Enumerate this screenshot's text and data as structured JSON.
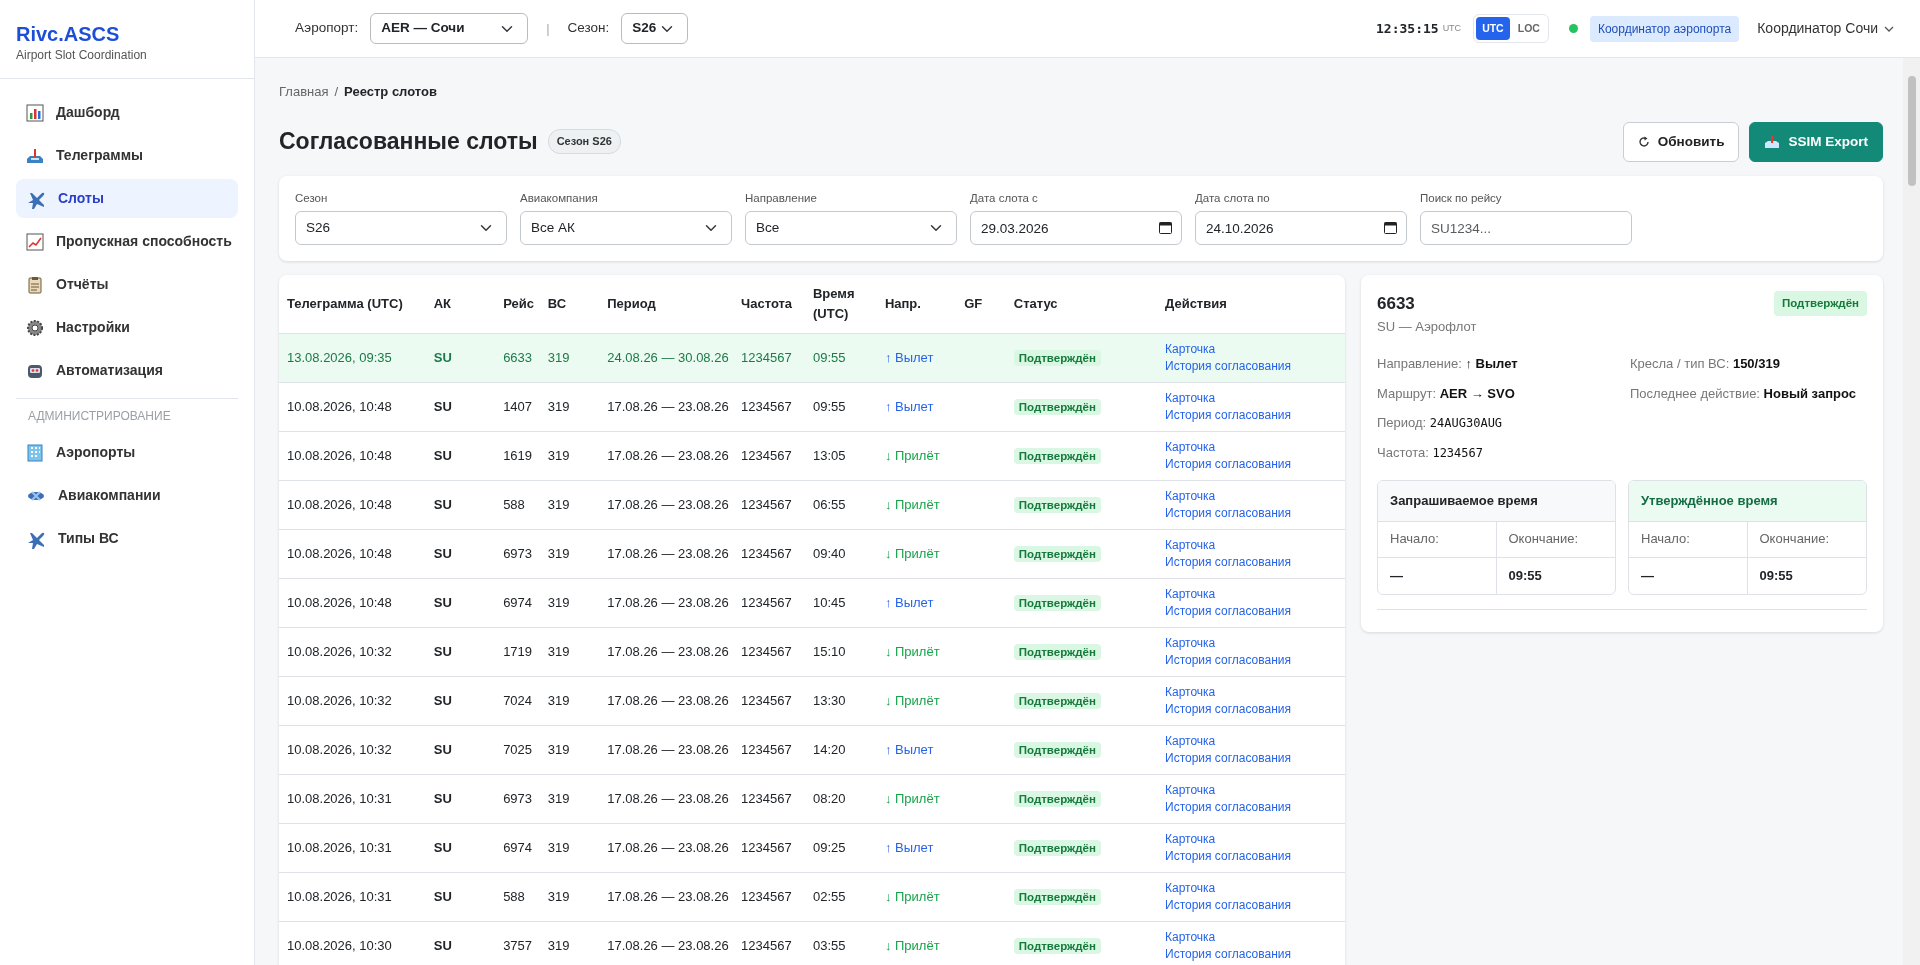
{
  "brand": {
    "title": "Rivc.ASCS",
    "subtitle": "Airport Slot Coordination"
  },
  "sidebar": {
    "items": [
      {
        "label": "Дашборд",
        "selected": false
      },
      {
        "label": "Телеграммы",
        "selected": false
      },
      {
        "label": "Слоты",
        "selected": true
      },
      {
        "label": "Пропускная способность",
        "selected": false
      },
      {
        "label": "Отчёты",
        "selected": false
      },
      {
        "label": "Настройки",
        "selected": false
      },
      {
        "label": "Автоматизация",
        "selected": false
      }
    ],
    "section_title": "АДМИНИСТРИРОВАНИЕ",
    "admin_items": [
      {
        "label": "Аэропорты",
        "selected": false
      },
      {
        "label": "Авиакомпании",
        "selected": false
      },
      {
        "label": "Типы ВС",
        "selected": false
      }
    ]
  },
  "topbar": {
    "airport_label": "Аэропорт:",
    "airport_value": "AER — Сочи",
    "separator": "|",
    "season_label": "Сезон:",
    "season_value": "S26",
    "clock": "12:35:15",
    "clock_zone": "UTC",
    "time_modes": [
      {
        "label": "UTC",
        "selected": true
      },
      {
        "label": "LOC",
        "selected": false
      }
    ],
    "online": true,
    "role_badge": "Координатор аэропорта",
    "user": "Координатор Сочи"
  },
  "breadcrumb": {
    "separator": "/",
    "items": [
      {
        "label": "Главная",
        "selected": false
      },
      {
        "label": "Реестр слотов",
        "selected": true
      }
    ]
  },
  "page": {
    "title": "Согласованные слоты",
    "season_badge": "Сезон S26",
    "buttons": [
      {
        "label": "Обновить",
        "kind": "refresh"
      },
      {
        "label": "SSIM Export",
        "kind": "export"
      }
    ]
  },
  "filters": [
    {
      "label": "Сезон",
      "kind": "select",
      "value": "S26"
    },
    {
      "label": "Авиакомпания",
      "kind": "select",
      "value": "Все АК"
    },
    {
      "label": "Направление",
      "kind": "select",
      "value": "Все"
    },
    {
      "label": "Дата слота с",
      "kind": "date",
      "value": "29.03.2026"
    },
    {
      "label": "Дата слота по",
      "kind": "date",
      "value": "24.10.2026"
    },
    {
      "label": "Поиск по рейсу",
      "kind": "text",
      "placeholder": "SU1234..."
    }
  ],
  "table": {
    "columns": [
      "Телеграмма (UTC)",
      "АК",
      "Рейс",
      "ВС",
      "Период",
      "Частота",
      "Время (UTC)",
      "Напр.",
      "GF",
      "Статус",
      "Действия"
    ],
    "rows": [
      {
        "telegram": "13.08.2026, 09:35",
        "airline": "SU",
        "flight": "6633",
        "aircraft": "319",
        "period": "24.08.26 — 30.08.26",
        "frequency": "1234567",
        "time": "09:55",
        "direction": "↑ Вылет",
        "kind": "dep",
        "status": "Подтверждён",
        "actions": [
          "Карточка",
          "История согласования"
        ],
        "selected": true
      },
      {
        "telegram": "10.08.2026, 10:48",
        "airline": "SU",
        "flight": "1407",
        "aircraft": "319",
        "period": "17.08.26 — 23.08.26",
        "frequency": "1234567",
        "time": "09:55",
        "direction": "↑ Вылет",
        "kind": "dep",
        "status": "Подтверждён",
        "actions": [
          "Карточка",
          "История согласования"
        ],
        "selected": false
      },
      {
        "telegram": "10.08.2026, 10:48",
        "airline": "SU",
        "flight": "1619",
        "aircraft": "319",
        "period": "17.08.26 — 23.08.26",
        "frequency": "1234567",
        "time": "13:05",
        "direction": "↓ Прилёт",
        "kind": "arr",
        "status": "Подтверждён",
        "actions": [
          "Карточка",
          "История согласования"
        ],
        "selected": false
      },
      {
        "telegram": "10.08.2026, 10:48",
        "airline": "SU",
        "flight": "588",
        "aircraft": "319",
        "period": "17.08.26 — 23.08.26",
        "frequency": "1234567",
        "time": "06:55",
        "direction": "↓ Прилёт",
        "kind": "arr",
        "status": "Подтверждён",
        "actions": [
          "Карточка",
          "История согласования"
        ],
        "selected": false
      },
      {
        "telegram": "10.08.2026, 10:48",
        "airline": "SU",
        "flight": "6973",
        "aircraft": "319",
        "period": "17.08.26 — 23.08.26",
        "frequency": "1234567",
        "time": "09:40",
        "direction": "↓ Прилёт",
        "kind": "arr",
        "status": "Подтверждён",
        "actions": [
          "Карточка",
          "История согласования"
        ],
        "selected": false
      },
      {
        "telegram": "10.08.2026, 10:48",
        "airline": "SU",
        "flight": "6974",
        "aircraft": "319",
        "period": "17.08.26 — 23.08.26",
        "frequency": "1234567",
        "time": "10:45",
        "direction": "↑ Вылет",
        "kind": "dep",
        "status": "Подтверждён",
        "actions": [
          "Карточка",
          "История согласования"
        ],
        "selected": false
      },
      {
        "telegram": "10.08.2026, 10:32",
        "airline": "SU",
        "flight": "1719",
        "aircraft": "319",
        "period": "17.08.26 — 23.08.26",
        "frequency": "1234567",
        "time": "15:10",
        "direction": "↓ Прилёт",
        "kind": "arr",
        "status": "Подтверждён",
        "actions": [
          "Карточка",
          "История согласования"
        ],
        "selected": false
      },
      {
        "telegram": "10.08.2026, 10:32",
        "airline": "SU",
        "flight": "7024",
        "aircraft": "319",
        "period": "17.08.26 — 23.08.26",
        "frequency": "1234567",
        "time": "13:30",
        "direction": "↓ Прилёт",
        "kind": "arr",
        "status": "Подтверждён",
        "actions": [
          "Карточка",
          "История согласования"
        ],
        "selected": false
      },
      {
        "telegram": "10.08.2026, 10:32",
        "airline": "SU",
        "flight": "7025",
        "aircraft": "319",
        "period": "17.08.26 — 23.08.26",
        "frequency": "1234567",
        "time": "14:20",
        "direction": "↑ Вылет",
        "kind": "dep",
        "status": "Подтверждён",
        "actions": [
          "Карточка",
          "История согласования"
        ],
        "selected": false
      },
      {
        "telegram": "10.08.2026, 10:31",
        "airline": "SU",
        "flight": "6973",
        "aircraft": "319",
        "period": "17.08.26 — 23.08.26",
        "frequency": "1234567",
        "time": "08:20",
        "direction": "↓ Прилёт",
        "kind": "arr",
        "status": "Подтверждён",
        "actions": [
          "Карточка",
          "История согласования"
        ],
        "selected": false
      },
      {
        "telegram": "10.08.2026, 10:31",
        "airline": "SU",
        "flight": "6974",
        "aircraft": "319",
        "period": "17.08.26 — 23.08.26",
        "frequency": "1234567",
        "time": "09:25",
        "direction": "↑ Вылет",
        "kind": "dep",
        "status": "Подтверждён",
        "actions": [
          "Карточка",
          "История согласования"
        ],
        "selected": false
      },
      {
        "telegram": "10.08.2026, 10:31",
        "airline": "SU",
        "flight": "588",
        "aircraft": "319",
        "period": "17.08.26 — 23.08.26",
        "frequency": "1234567",
        "time": "02:55",
        "direction": "↓ Прилёт",
        "kind": "arr",
        "status": "Подтверждён",
        "actions": [
          "Карточка",
          "История согласования"
        ],
        "selected": false
      },
      {
        "telegram": "10.08.2026, 10:30",
        "airline": "SU",
        "flight": "3757",
        "aircraft": "319",
        "period": "17.08.26 — 23.08.26",
        "frequency": "1234567",
        "time": "03:55",
        "direction": "↓ Прилёт",
        "kind": "arr",
        "status": "Подтверждён",
        "actions": [
          "Карточка",
          "История согласования"
        ],
        "selected": false
      }
    ]
  },
  "detail": {
    "title": "6633",
    "subtitle": "SU — Аэрофлот",
    "status": "Подтверждён",
    "fields_left": [
      {
        "label": "Направление:",
        "value": "↑ Вылет",
        "kind": "bold"
      },
      {
        "label": "Маршрут:",
        "value": "AER → SVO",
        "kind": "bold"
      },
      {
        "label": "Период:",
        "value": "24AUG30AUG",
        "kind": "mono"
      },
      {
        "label": "Частота:",
        "value": "1234567",
        "kind": "mono"
      }
    ],
    "fields_right": [
      {
        "label": "Кресла / тип ВС:",
        "value": "150/319",
        "kind": "bold"
      },
      {
        "label": "Последнее действие:",
        "value": "Новый запрос",
        "kind": "bold"
      }
    ],
    "time_boxes": [
      {
        "title": "Запрашиваемое время",
        "kind": "requested",
        "start_label": "Начало:",
        "end_label": "Окончание:",
        "start": "—",
        "end": "09:55"
      },
      {
        "title": "Утверждённое время",
        "kind": "approved",
        "start_label": "Начало:",
        "end_label": "Окончание:",
        "start": "—",
        "end": "09:55"
      }
    ]
  }
}
